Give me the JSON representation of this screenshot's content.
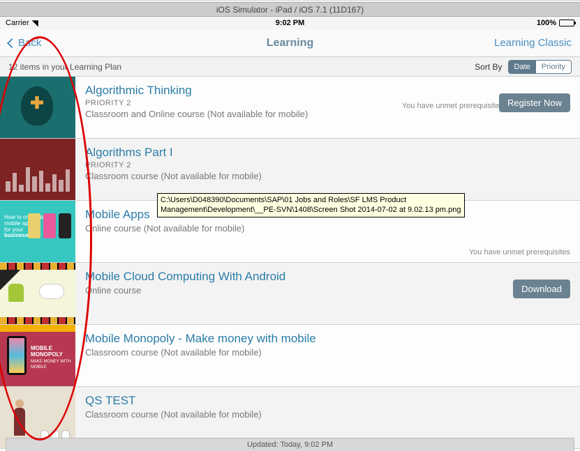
{
  "simulator_title": "iOS Simulator - iPad / iOS 7.1 (11D167)",
  "status": {
    "carrier": "Carrier",
    "time": "9:02 PM",
    "battery": "100%"
  },
  "nav": {
    "back": "Back",
    "title": "Learning",
    "right": "Learning Classic"
  },
  "subheader": {
    "count_text": "12 items in your Learning Plan",
    "sort_label": "Sort By",
    "sort_options": {
      "date": "Date",
      "priority": "Priority"
    },
    "active_sort": "Date"
  },
  "items": [
    {
      "title": "Algorithmic Thinking",
      "priority": "PRIORITY  2",
      "desc": "Classroom and Online course (Not available for mobile)",
      "note": "You have unmet prerequisites",
      "action": "Register Now"
    },
    {
      "title": "Algorithms Part I",
      "priority": "PRIORITY  2",
      "desc": "Classroom course (Not available for mobile)",
      "note": "",
      "action": ""
    },
    {
      "title": "Mobile Apps",
      "priority": "",
      "desc": "Online course (Not available for mobile)",
      "note": "You have unmet prerequisites",
      "action": ""
    },
    {
      "title": "Mobile Cloud Computing With Android",
      "priority": "",
      "desc": "Online course",
      "note": "",
      "action": "Download"
    },
    {
      "title": "Mobile Monopoly - Make money with mobile",
      "priority": "",
      "desc": "Classroom course (Not available for mobile)",
      "note": "",
      "action": ""
    },
    {
      "title": "QS TEST",
      "priority": "",
      "desc": "Classroom course (Not available for mobile)",
      "note": "",
      "action": ""
    }
  ],
  "footer": "Updated: Today, 9:02 PM",
  "tooltip_line1": "C:\\Users\\D048390\\Documents\\SAP\\01 Jobs and Roles\\SF LMS Product",
  "tooltip_line2": "Management\\Development\\__PE-SVN\\1408\\Screen Shot 2014-07-02 at 9.02.13 pm.png"
}
